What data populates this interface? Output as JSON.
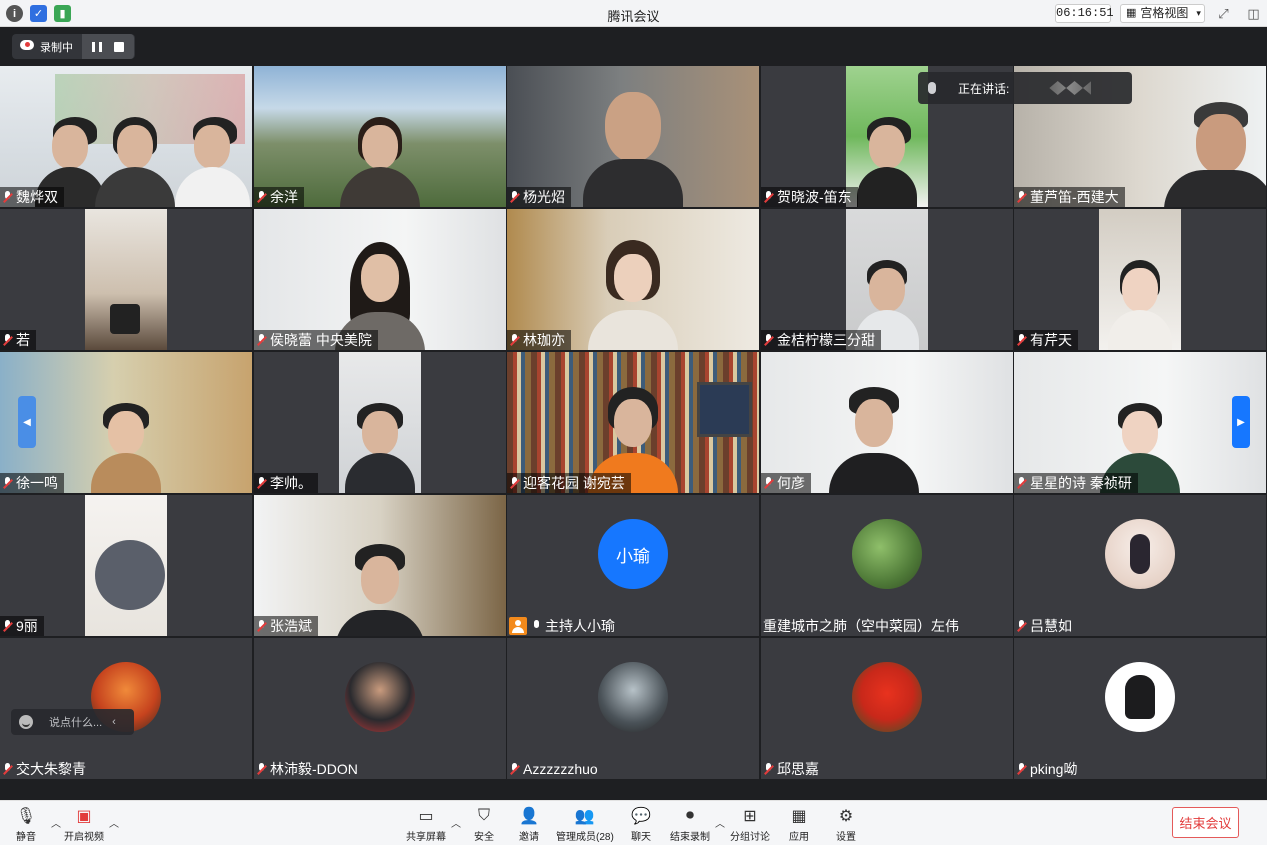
{
  "title_bar": {
    "title": "腾讯会议",
    "timer": "06:16:51",
    "view_mode": "宫格视图",
    "icons": [
      "info-icon",
      "shield-icon",
      "signal-icon",
      "fullscreen-icon",
      "sidebar-icon"
    ]
  },
  "recording": {
    "label": "录制中"
  },
  "speaking": {
    "label": "正在讲话:"
  },
  "chat": {
    "placeholder": "说点什么..."
  },
  "participants": [
    {
      "name": "魏烨双",
      "muted": true
    },
    {
      "name": "余洋",
      "muted": true
    },
    {
      "name": "杨光炤",
      "muted": true
    },
    {
      "name": "贺晓波-笛东",
      "muted": true
    },
    {
      "name": "董芦笛-西建大",
      "muted": true
    },
    {
      "name": "若",
      "muted": true
    },
    {
      "name": "侯晓蕾 中央美院",
      "muted": true
    },
    {
      "name": "林珈亦",
      "muted": true
    },
    {
      "name": "金桔柠檬三分甜",
      "muted": true
    },
    {
      "name": "有芹天",
      "muted": true
    },
    {
      "name": "徐一鸣",
      "muted": true
    },
    {
      "name": "李帅。",
      "muted": true
    },
    {
      "name": "迎客花园 谢宛芸",
      "muted": true
    },
    {
      "name": "何彦",
      "muted": true
    },
    {
      "name": "星星的诗 秦祯研",
      "muted": true
    },
    {
      "name": "9丽",
      "muted": true
    },
    {
      "name": "张浩斌",
      "muted": true
    },
    {
      "name": "主持人小瑜",
      "muted": false,
      "host": true,
      "avatar_text": "小瑜"
    },
    {
      "name": "重建城市之肺（空中菜园）左伟",
      "muted": false
    },
    {
      "name": "吕慧如",
      "muted": true
    },
    {
      "name": "交大朱黎青",
      "muted": true
    },
    {
      "name": "林沛毅-DDON",
      "muted": true
    },
    {
      "name": "Azzzzzzhuo",
      "muted": true
    },
    {
      "name": "邱思嘉",
      "muted": true
    },
    {
      "name": "pking呦",
      "muted": true
    }
  ],
  "toolbar": {
    "mute": "静音",
    "video": "开启视频",
    "share": "共享屏幕",
    "security": "安全",
    "invite": "邀请",
    "members": "管理成员(28)",
    "chat": "聊天",
    "end_record": "结束录制",
    "breakout": "分组讨论",
    "apps": "应用",
    "settings": "设置",
    "end_meeting": "结束会议"
  },
  "colors": {
    "host_avatar": "#1677ff",
    "end_red": "#e23c3c",
    "host_badge": "#f38a1c"
  }
}
